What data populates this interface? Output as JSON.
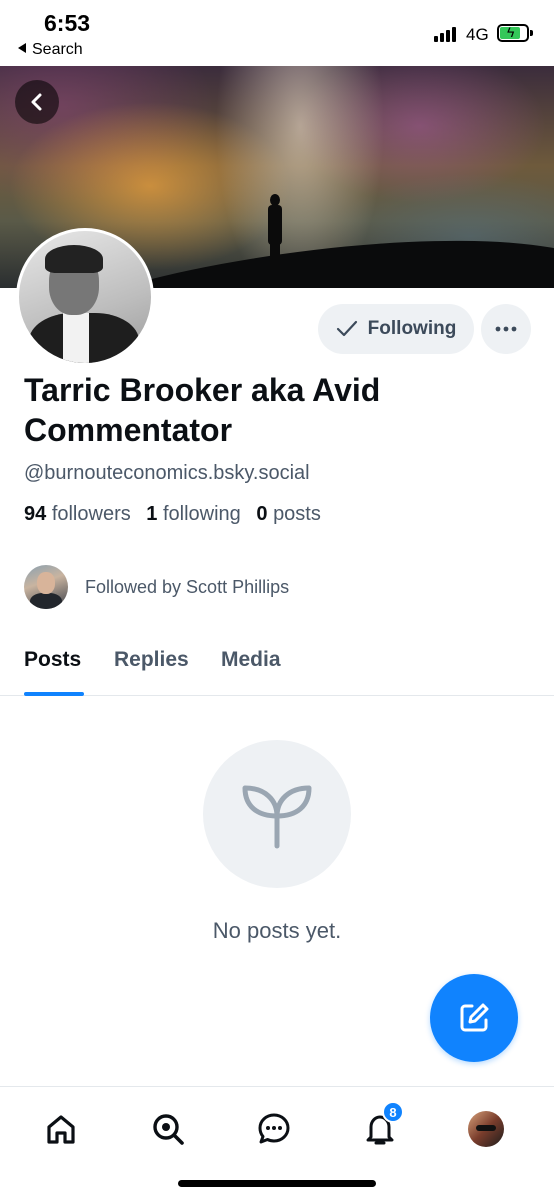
{
  "status_bar": {
    "time": "6:53",
    "back_app": "Search",
    "network": "4G"
  },
  "profile": {
    "display_name": "Tarric Brooker aka Avid Commentator",
    "handle": "@burnouteconomics.bsky.social",
    "followers_count": "94",
    "followers_label": "followers",
    "following_count": "1",
    "following_label": "following",
    "posts_count": "0",
    "posts_label": "posts",
    "followed_by": "Followed by Scott Phillips"
  },
  "actions": {
    "following_label": "Following"
  },
  "tabs": [
    {
      "label": "Posts",
      "active": true
    },
    {
      "label": "Replies",
      "active": false
    },
    {
      "label": "Media",
      "active": false
    }
  ],
  "empty_state": {
    "message": "No posts yet.",
    "icon": "sprout-icon"
  },
  "bottom_nav": {
    "items": [
      "home-icon",
      "search-icon",
      "chat-icon",
      "bell-icon",
      "profile-avatar"
    ],
    "notifications_badge": "8"
  },
  "colors": {
    "accent": "#1083fe",
    "muted_text": "#4b5868",
    "button_bg": "#eef1f4"
  }
}
